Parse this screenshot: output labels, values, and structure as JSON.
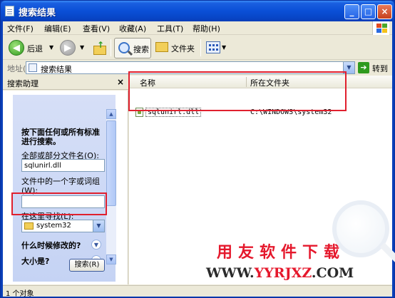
{
  "window": {
    "title": "搜索结果"
  },
  "menu": [
    "文件(F)",
    "编辑(E)",
    "查看(V)",
    "收藏(A)",
    "工具(T)",
    "帮助(H)"
  ],
  "toolbar": {
    "back_label": "后退",
    "search_label": "搜索",
    "folders_label": "文件夹"
  },
  "address": {
    "label": "地址(D)",
    "value": "搜索结果",
    "go_label": "转到"
  },
  "search_pane": {
    "title": "搜索助理",
    "prompt": "按下面任何或所有标准进行搜索。",
    "filename_label": "全部或部分文件名(O):",
    "filename_value": "sqlunirl.dll",
    "phrase_label": "文件中的一个字或词组(W):",
    "phrase_value": "",
    "lookin_label": "在这里寻找(L):",
    "lookin_value": "system32",
    "when_modified": "什么时候修改的?",
    "size_label": "大小是?",
    "search_button": "搜索(R)"
  },
  "results": {
    "columns": [
      "名称",
      "所在文件夹"
    ],
    "rows": [
      {
        "name": "sqlunirl.dll",
        "folder": "C:\\WINDOWS\\system32"
      }
    ]
  },
  "watermark": {
    "brand": "用友软件下载",
    "url_prefix": "WWW.",
    "url_main": "YYRJXZ",
    "url_suffix": ".COM"
  },
  "status": {
    "text": "1 个对象"
  },
  "colors": {
    "title_blue": "#0a4fd6",
    "highlight_red": "#e0202e",
    "brand_red": "#e5182c"
  }
}
